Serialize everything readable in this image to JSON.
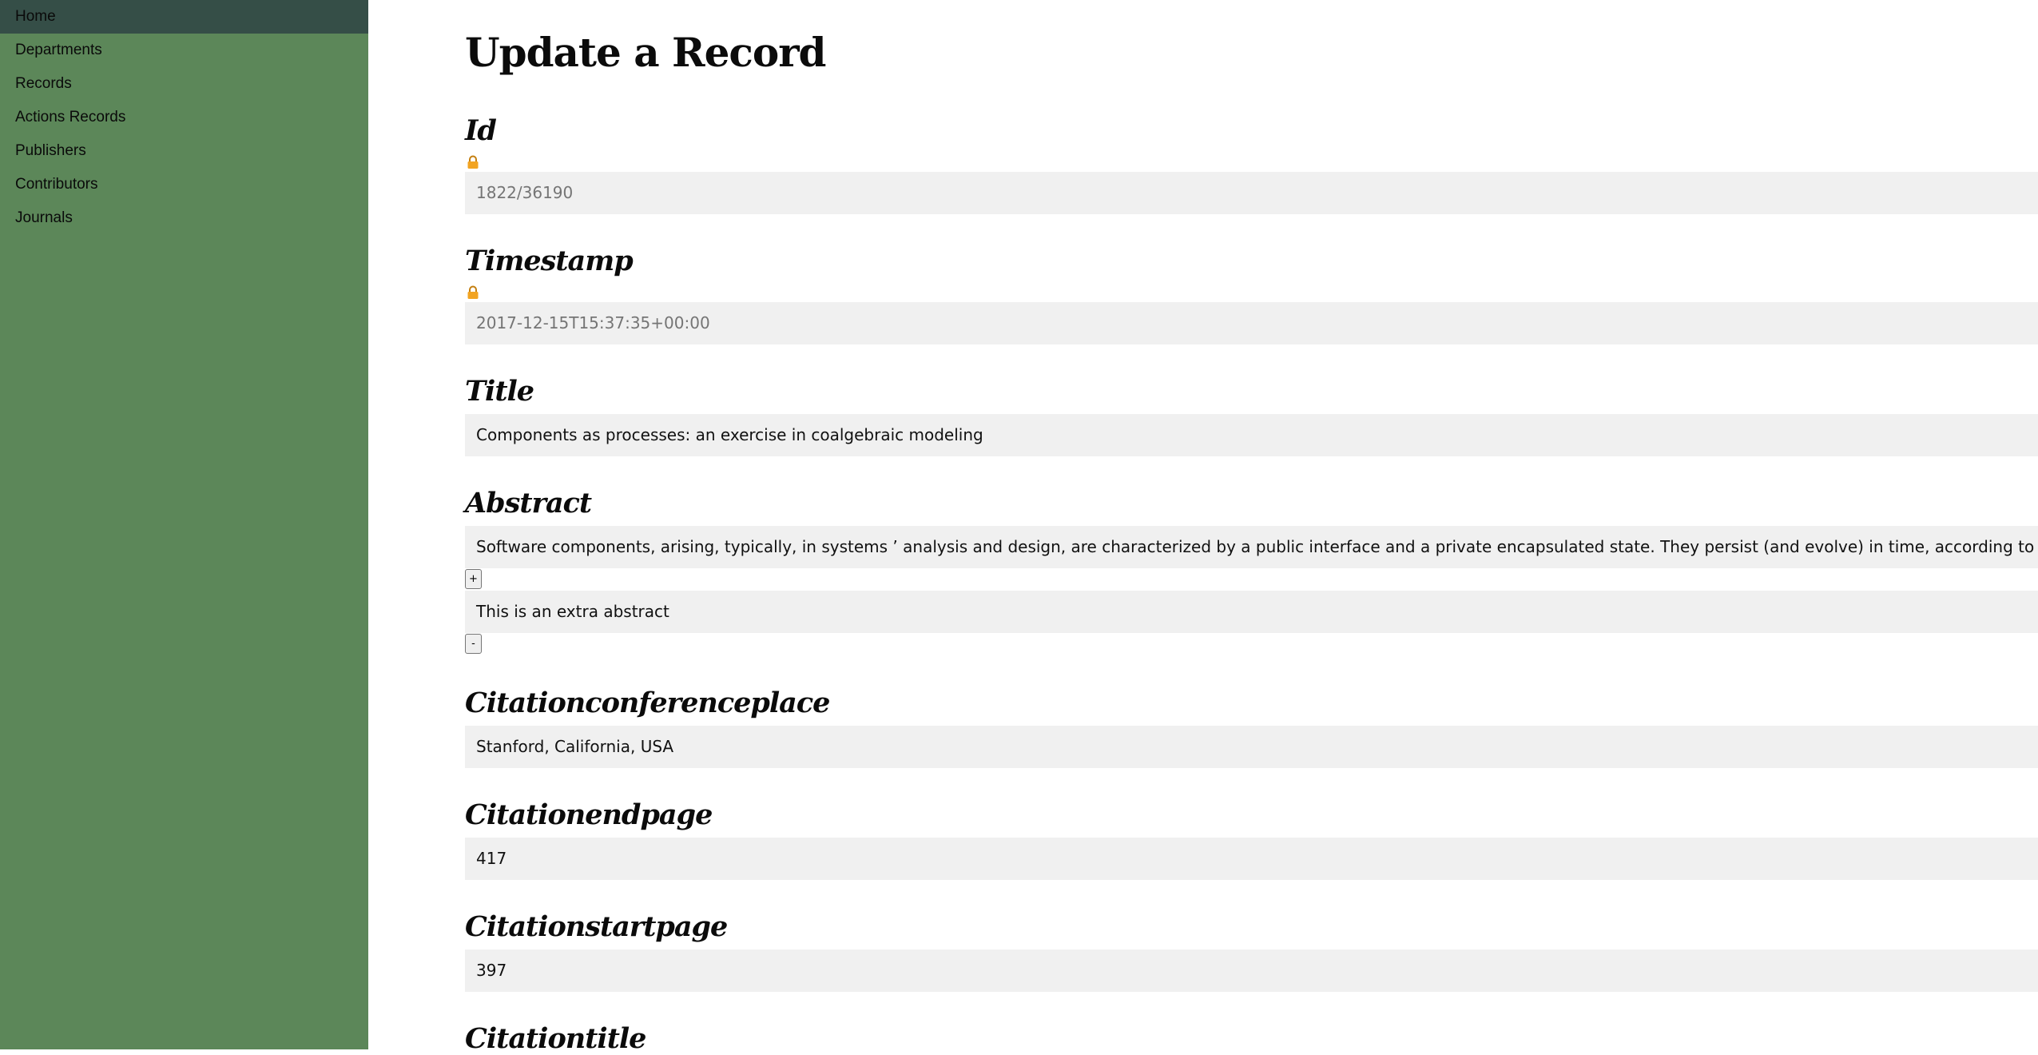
{
  "sidebar": {
    "items": [
      {
        "label": "Home"
      },
      {
        "label": "Departments"
      },
      {
        "label": "Records"
      },
      {
        "label": "Actions Records"
      },
      {
        "label": "Publishers"
      },
      {
        "label": "Contributors"
      },
      {
        "label": "Journals"
      }
    ],
    "active": "Home"
  },
  "page": {
    "title": "Update a Record"
  },
  "fields": {
    "id": {
      "label": "Id",
      "value": "1822/36190",
      "locked": true
    },
    "timestamp": {
      "label": "Timestamp",
      "value": "2017-12-15T15:37:35+00:00",
      "locked": true
    },
    "title": {
      "label": "Title",
      "value": "Components as processes: an exercise in coalgebraic modeling"
    },
    "abstract": {
      "label": "Abstract",
      "values": [
        "Software components, arising, typically, in systems ’ analysis and design, are characterized by a public interface and a private encapsulated state. They persist (and evolve) in time, according to some behavioural patte",
        "This is an extra abstract"
      ],
      "add_label": "+",
      "remove_label": "-"
    },
    "citationconferenceplace": {
      "label": "Citationconferenceplace",
      "value": "Stanford, California, USA"
    },
    "citationendpage": {
      "label": "Citationendpage",
      "value": "417"
    },
    "citationstartpage": {
      "label": "Citationstartpage",
      "value": "397"
    },
    "citationtitle": {
      "label": "Citationtitle"
    }
  },
  "colors": {
    "sidebar_bg": "#5c8759",
    "sidebar_active_bg": "#354e47",
    "field_bg": "#f0f0f0",
    "lock_icon": "#f2a422"
  },
  "icons": {
    "lock": "lock-icon"
  }
}
